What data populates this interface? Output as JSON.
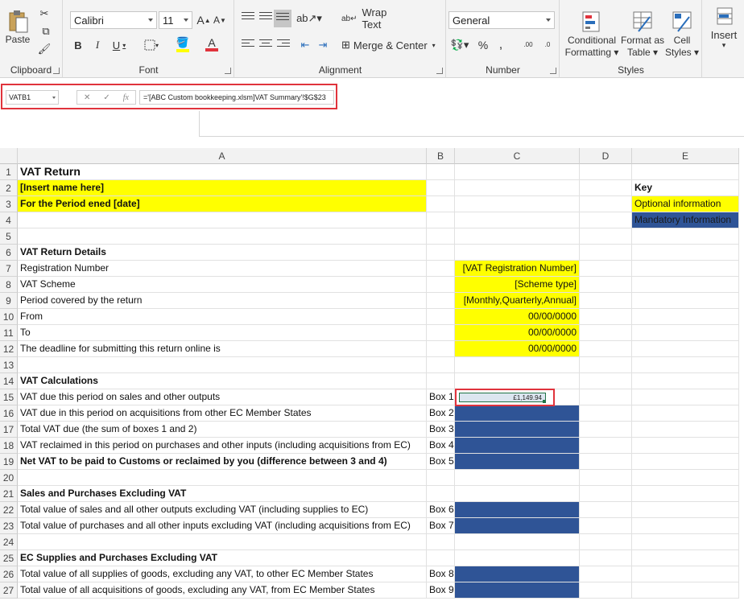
{
  "ribbon": {
    "clipboard": {
      "paste": "Paste",
      "label": "Clipboard"
    },
    "font": {
      "name": "Calibri",
      "size": "11",
      "label": "Font",
      "bold": "B",
      "italic": "I",
      "underline": "U",
      "grow": "A",
      "shrink": "A"
    },
    "alignment": {
      "wrap_text": "Wrap Text",
      "merge_center": "Merge & Center",
      "label": "Alignment"
    },
    "number": {
      "format": "General",
      "percent": "%",
      "comma": ",",
      "inc_dec": ".00",
      "dec_dec": ".0",
      "label": "Number"
    },
    "styles": {
      "conditional": "Conditional",
      "formatting": "Formatting",
      "format_as": "Format as",
      "table": "Table",
      "cell": "Cell",
      "styles_btn": "Styles",
      "label": "Styles"
    },
    "cells": {
      "insert": "Insert"
    },
    "colors": {
      "highlight": "#ffff00",
      "font_color": "#e0333c"
    }
  },
  "formula_bar": {
    "name_box": "VATB1",
    "formula": "='[ABC Custom bookkeeping.xlsm]VAT Summary'!$G$23",
    "cancel": "✕",
    "enter": "✓",
    "fx": "fx"
  },
  "columns": [
    "A",
    "B",
    "C",
    "D",
    "E"
  ],
  "rows": [
    "1",
    "2",
    "3",
    "4",
    "5",
    "6",
    "7",
    "8",
    "9",
    "10",
    "11",
    "12",
    "13",
    "14",
    "15",
    "16",
    "17",
    "18",
    "19",
    "20",
    "21",
    "22",
    "23",
    "24",
    "25",
    "26",
    "27"
  ],
  "sheet": {
    "title": "VAT Return",
    "name_placeholder": "[Insert name here]",
    "period": "For the Period ened [date]",
    "details_header": "VAT Return Details",
    "reg_number": "Registration Number",
    "vat_scheme": "VAT Scheme",
    "period_covered": "Period covered by the return",
    "from": "From",
    "to": "To",
    "deadline": "The deadline for submitting this return online is",
    "reg_value": "[VAT Registration Number]",
    "scheme_value": "[Scheme type]",
    "period_value": "[Monthly,Quarterly,Annual]",
    "from_value": "00/00/0000",
    "to_value": "00/00/0000",
    "deadline_value": "00/00/0000",
    "calc_header": "VAT Calculations",
    "row15": "VAT due this period on sales and other outputs",
    "row16": "VAT due in this period on acquisitions from other EC Member States",
    "row17": "Total VAT due (the sum of boxes 1 and 2)",
    "row18": "VAT reclaimed in this period on purchases and other inputs (including acquisitions from EC)",
    "row19": "Net VAT to be paid to Customs or reclaimed by you (difference between 3 and 4)",
    "box1": "Box 1",
    "box2": "Box 2",
    "box3": "Box 3",
    "box4": "Box 4",
    "box5": "Box 5",
    "box1_value": "£1,149.94",
    "sales_header": "Sales and Purchases Excluding VAT",
    "row22": "Total value of sales and all other outputs excluding VAT (including supplies to EC)",
    "row23": "Total value of purchases and all other inputs excluding VAT (including acquisitions from EC)",
    "box6": "Box 6",
    "box7": "Box 7",
    "ec_header": "EC Supplies and Purchases Excluding VAT",
    "row26": "Total value of all supplies of goods, excluding any VAT, to other EC Member States",
    "row27": "Total value of all acquisitions of goods, excluding any VAT, from EC Member States",
    "box8": "Box 8",
    "box9": "Box 9",
    "key_header": "Key",
    "key_optional": "Optional information",
    "key_mandatory": "Mandatory Information",
    "colors": {
      "optional": "#ffff00",
      "mandatory": "#2f5496"
    }
  }
}
